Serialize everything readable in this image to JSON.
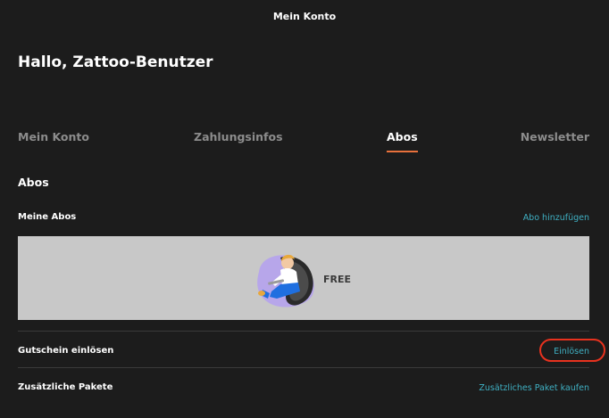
{
  "page": {
    "title": "Mein Konto"
  },
  "greeting": "Hallo, Zattoo-Benutzer",
  "tabs": [
    {
      "label": "Mein Konto",
      "active": false
    },
    {
      "label": "Zahlungsinfos",
      "active": false
    },
    {
      "label": "Abos",
      "active": true
    },
    {
      "label": "Newsletter",
      "active": false
    }
  ],
  "section": {
    "title": "Abos"
  },
  "subscriptions": {
    "label": "Meine Abos",
    "add_link": "Abo hinzufügen",
    "card": {
      "label": "FREE",
      "illustration": "person-in-seat-illustration"
    }
  },
  "voucher": {
    "label": "Gutschein einlösen",
    "action": "Einlösen"
  },
  "packages": {
    "label": "Zusätzliche Pakete",
    "action": "Zusätzliches Paket kaufen"
  },
  "colors": {
    "background": "#1c1c1c",
    "accent_underline": "#e8713c",
    "link": "#3fb0c3",
    "card_background": "#c8c8c8",
    "highlight_ring": "#e8321e"
  }
}
